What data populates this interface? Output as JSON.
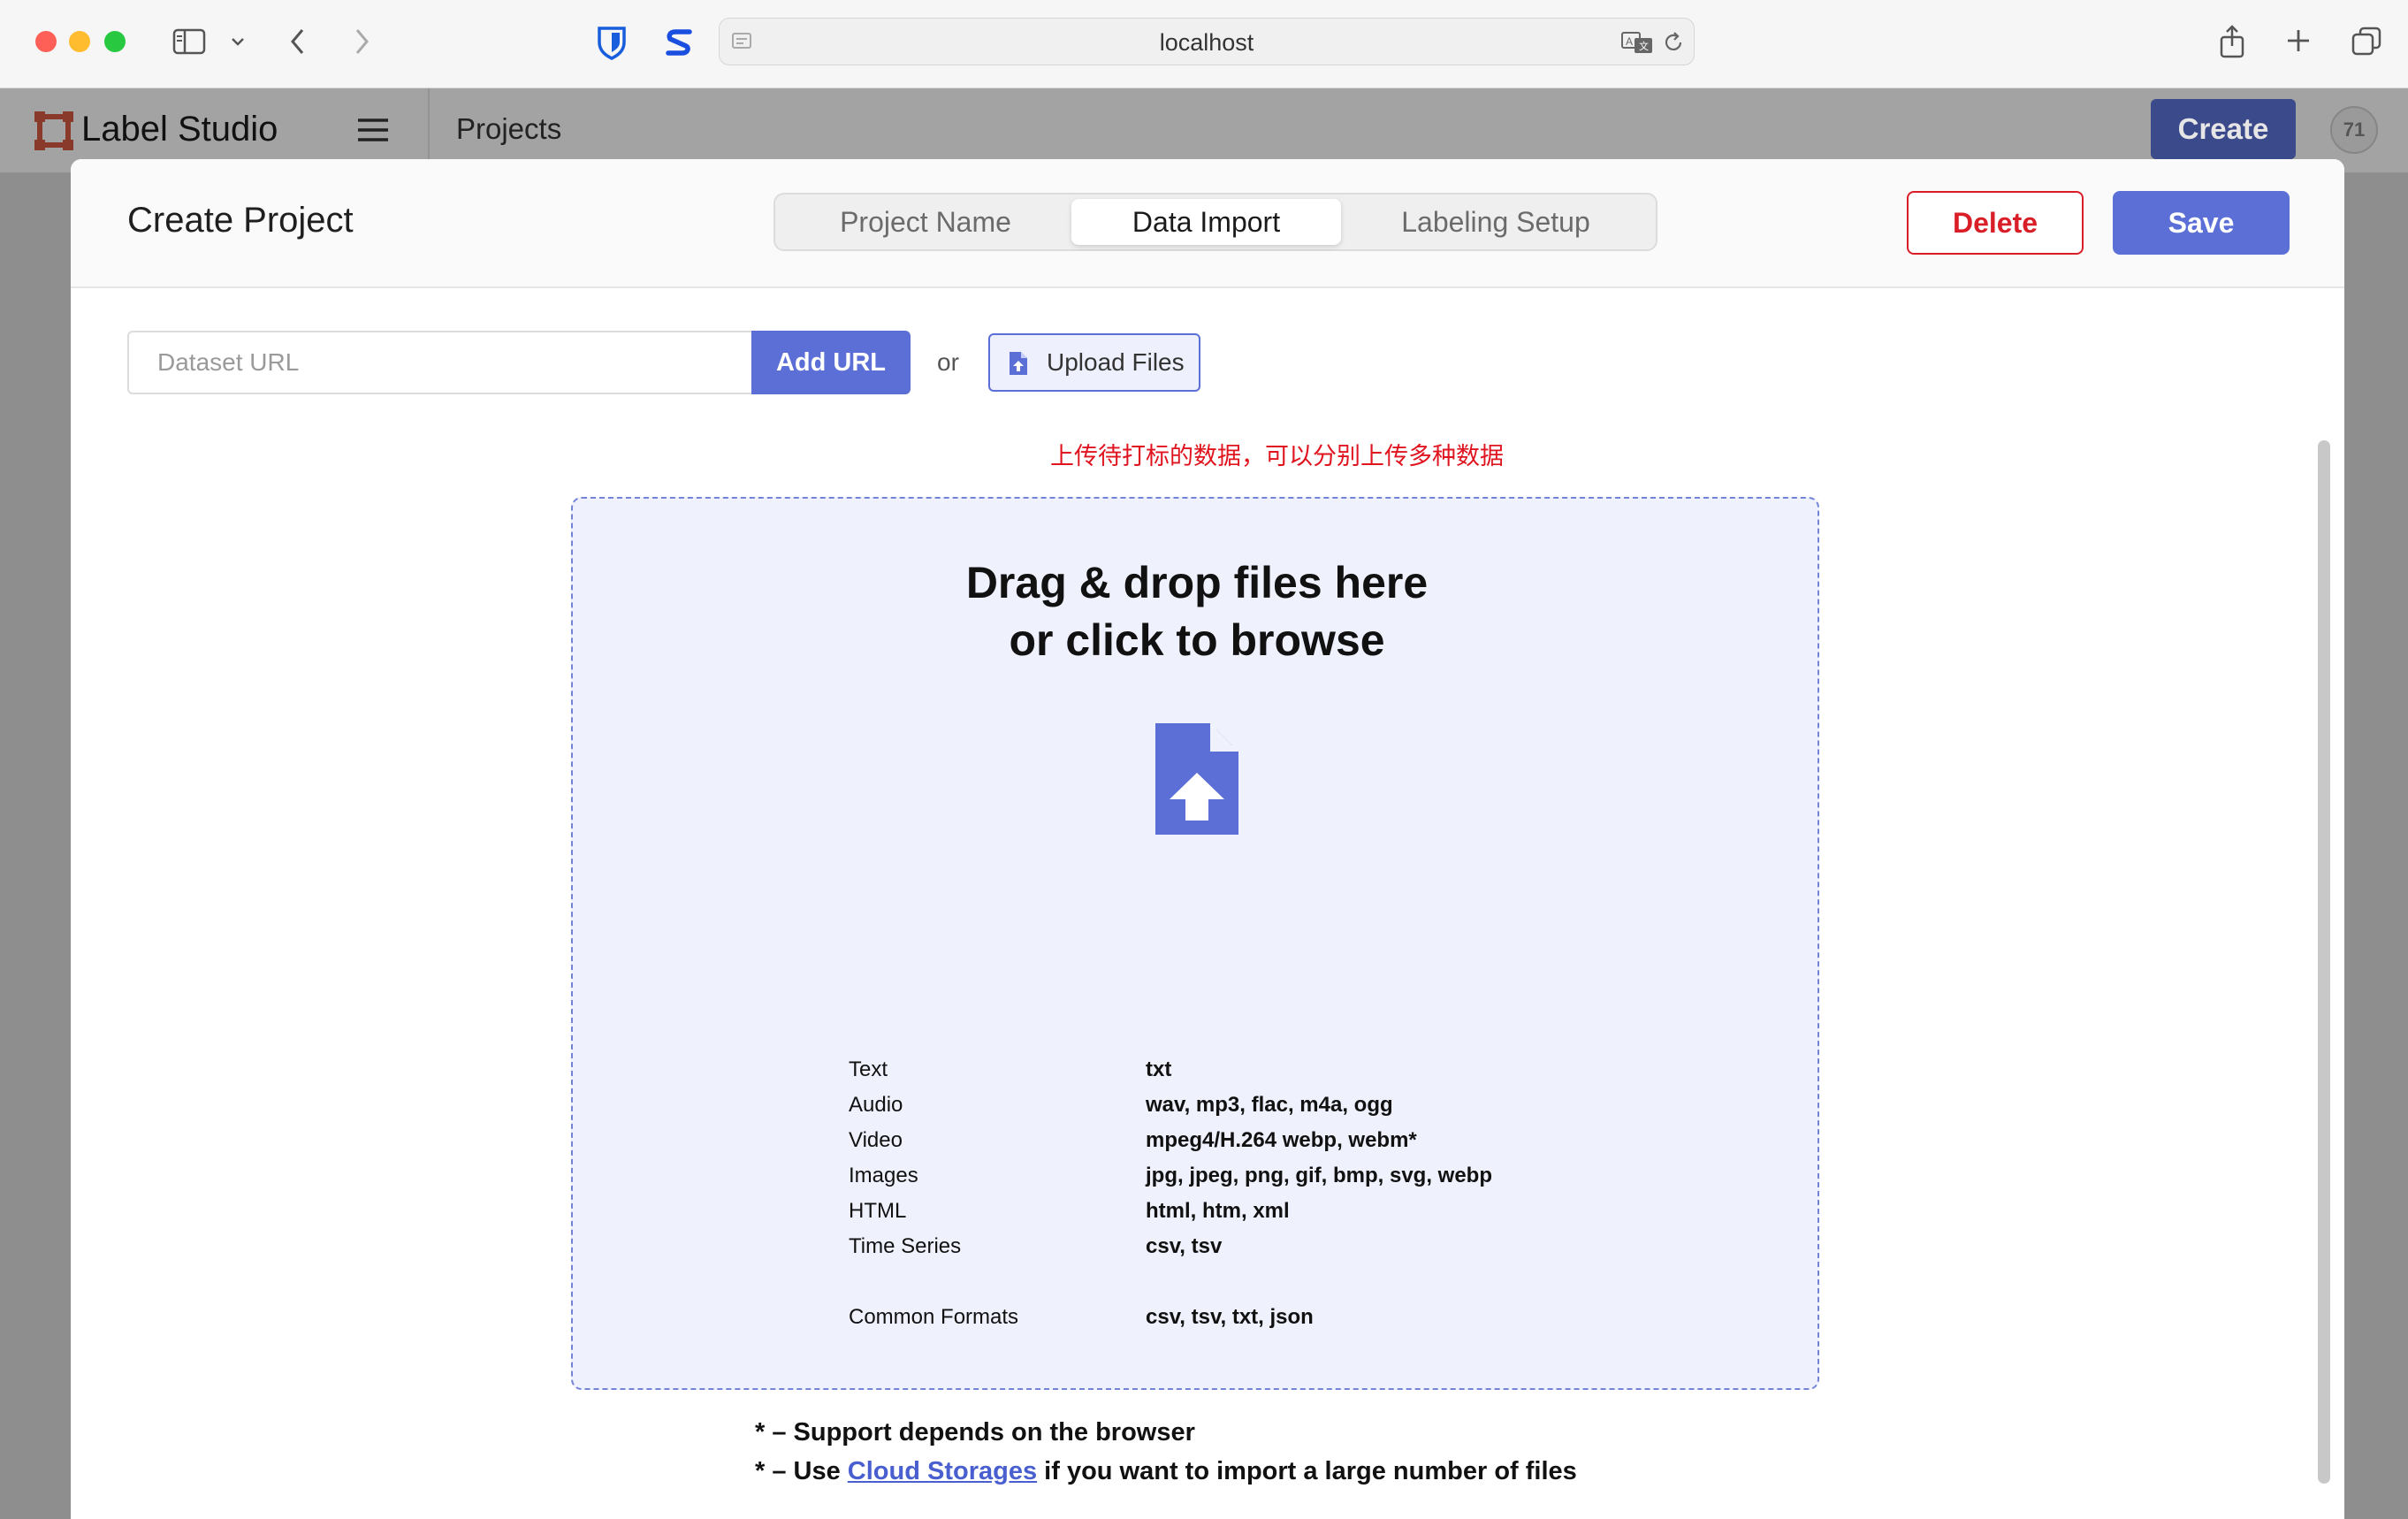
{
  "browser": {
    "address": "localhost",
    "icons": [
      "sidebar-toggle-icon",
      "chevron-down-icon",
      "back-icon",
      "forward-icon",
      "bitwarden-shield-icon",
      "s-extension-icon",
      "page-icon",
      "translate-icon",
      "reload-icon",
      "share-icon",
      "new-tab-icon",
      "tabs-overview-icon"
    ]
  },
  "app": {
    "brand": "Label Studio",
    "breadcrumb": "Projects",
    "create_label": "Create",
    "avatar_initials": "71"
  },
  "modal": {
    "title": "Create Project",
    "tabs": [
      {
        "label": "Project Name",
        "active": false
      },
      {
        "label": "Data Import",
        "active": true
      },
      {
        "label": "Labeling Setup",
        "active": false
      }
    ],
    "delete_label": "Delete",
    "save_label": "Save"
  },
  "import": {
    "url_placeholder": "Dataset URL",
    "add_url_label": "Add URL",
    "or_text": "or",
    "upload_label": "Upload Files",
    "annotation_note": "上传待打标的数据，可以分别上传多种数据",
    "drop_title_line1": "Drag & drop files here",
    "drop_title_line2": "or click to browse",
    "formats": [
      {
        "name": "Text",
        "ext": "txt"
      },
      {
        "name": "Audio",
        "ext": "wav, mp3, flac, m4a, ogg"
      },
      {
        "name": "Video",
        "ext": "mpeg4/H.264 webp, webm*"
      },
      {
        "name": "Images",
        "ext": "jpg, jpeg, png, gif, bmp, svg, webp"
      },
      {
        "name": "HTML",
        "ext": "html, htm, xml"
      },
      {
        "name": "Time Series",
        "ext": "csv, tsv"
      }
    ],
    "common": {
      "name": "Common Formats",
      "ext": "csv, tsv, txt, json"
    },
    "foot1": "* – Support depends on the browser",
    "foot2_prefix": "* – Use ",
    "foot2_link": "Cloud Storages",
    "foot2_suffix": " if you want to import a large number of files"
  },
  "colors": {
    "accent": "#5b6fd6",
    "danger": "#d91e28",
    "dropzone_bg": "#eff1fd",
    "annotation": "#e0141e"
  }
}
